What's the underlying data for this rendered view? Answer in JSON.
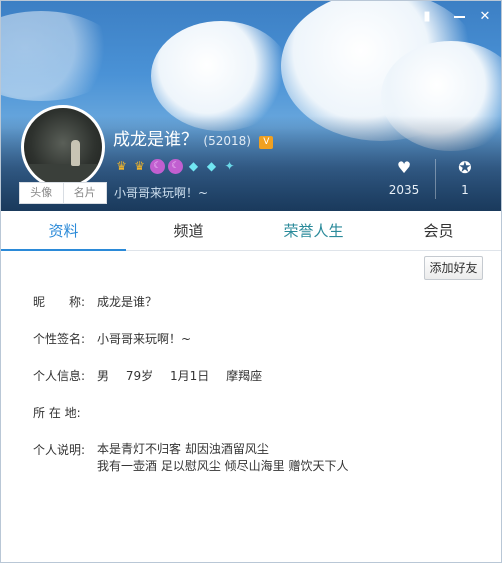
{
  "profile": {
    "nickname": "成龙是谁？",
    "uid": "(52018)",
    "vip_badge": "V",
    "signature": "小哥哥来玩啊！~",
    "avatar_tabs": [
      "头像",
      "名片"
    ]
  },
  "badges": [
    "crown-icon",
    "crown-icon",
    "moon-icon",
    "moon-icon",
    "diamond-icon",
    "diamond-icon",
    "star-icon"
  ],
  "stats": {
    "likes": "2035",
    "awards": "1"
  },
  "tabs": [
    {
      "label": "资料",
      "active": true
    },
    {
      "label": "频道",
      "active": false
    },
    {
      "label": "荣誉人生",
      "active": false
    },
    {
      "label": "会员",
      "active": false
    }
  ],
  "actions": {
    "add_friend": "添加好友"
  },
  "details": {
    "nickname_label": "昵　　称:",
    "nickname_value": "成龙是谁？",
    "signature_label": "个性签名:",
    "signature_value": "小哥哥来玩啊！~",
    "personal_label": "个人信息:",
    "gender": "男",
    "age": "79岁",
    "birthday": "1月1日",
    "zodiac": "摩羯座",
    "location_label": "所 在 地:",
    "location_value": "",
    "desc_label": "个人说明:",
    "desc_line1": "本是青灯不归客 却因浊酒留风尘",
    "desc_line2": "我有一壶酒 足以慰风尘 倾尽山海里 赠饮天下人"
  },
  "colors": {
    "accent": "#2b8ad8",
    "honor_tab": "#2a8a9a"
  }
}
